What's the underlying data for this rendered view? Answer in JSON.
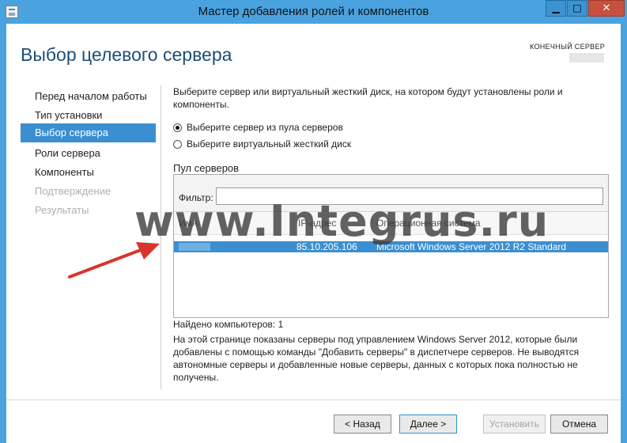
{
  "window": {
    "title": "Мастер добавления ролей и компонентов",
    "controls": {
      "minimize": "▁",
      "maximize": "□",
      "close": "✕"
    }
  },
  "header": {
    "page_title": "Выбор целевого сервера",
    "destination_label": "КОНЕЧНЫЙ СЕРВЕР"
  },
  "nav": {
    "items": [
      {
        "label": "Перед началом работы",
        "state": "normal"
      },
      {
        "label": "Тип установки",
        "state": "normal"
      },
      {
        "label": "Выбор сервера",
        "state": "active"
      },
      {
        "label": "Роли сервера",
        "state": "normal"
      },
      {
        "label": "Компоненты",
        "state": "normal"
      },
      {
        "label": "Подтверждение",
        "state": "disabled"
      },
      {
        "label": "Результаты",
        "state": "disabled"
      }
    ]
  },
  "main": {
    "description": "Выберите сервер или виртуальный жесткий диск, на котором будут установлены роли и компоненты.",
    "options": [
      {
        "label": "Выберите сервер из пула серверов",
        "checked": true
      },
      {
        "label": "Выберите виртуальный жесткий диск",
        "checked": false
      }
    ],
    "pool_title": "Пул серверов",
    "filter_label": "Фильтр:",
    "filter_value": "",
    "columns": {
      "name": "Имя",
      "ip": "IP-адрес",
      "os": "Операционная система"
    },
    "rows": [
      {
        "name": "",
        "ip": "85.10.205.106",
        "os": "Microsoft Windows Server 2012 R2 Standard"
      }
    ],
    "found_text": "Найдено компьютеров: 1",
    "info_text": "На этой странице показаны серверы под управлением Windows Server 2012, которые были добавлены с помощью команды \"Добавить серверы\" в диспетчере серверов. Не выводятся автономные серверы и добавленные новые серверы, данных с которых пока полностью не получены."
  },
  "footer": {
    "back": "< Назад",
    "next": "Далее >",
    "install": "Установить",
    "cancel": "Отмена"
  },
  "watermark": "www.Integrus.ru",
  "colors": {
    "titlebar": "#4aa3df",
    "selection": "#3b8fd0",
    "heading": "#1e4e79",
    "arrow": "#d9342b"
  }
}
